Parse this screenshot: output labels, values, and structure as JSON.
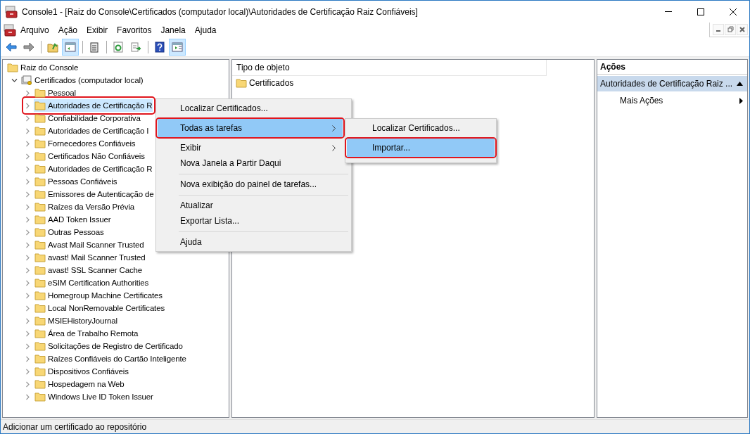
{
  "window": {
    "title": "Console1 - [Raiz do Console\\Certificados (computador local)\\Autoridades de Certificação Raiz Confiáveis]"
  },
  "menu_bar": [
    "Arquivo",
    "Ação",
    "Exibir",
    "Favoritos",
    "Janela",
    "Ajuda"
  ],
  "toolbar": [
    [
      {
        "pressed": false
      },
      {
        "pressed": false
      }
    ],
    [
      {
        "pressed": false
      },
      {
        "pressed": true
      }
    ],
    [
      {
        "pressed": false
      }
    ],
    [
      {
        "pressed": false
      },
      {
        "pressed": false
      }
    ],
    [
      {
        "pressed": false
      },
      {
        "pressed": true
      }
    ]
  ],
  "tree": [
    {
      "label": "Raiz do Console",
      "selected": false,
      "annotated": false,
      "children": [
        {
          "label": "Certificados (computador local)",
          "kind": "store",
          "expanded": true,
          "selected": false,
          "annotated": false,
          "children": [
            {
              "label": "Pessoal",
              "expanded": false,
              "selected": false,
              "annotated": false
            },
            {
              "label": "Autoridades de Certificação R",
              "expanded": false,
              "selected": true,
              "annotated": true
            },
            {
              "label": "Confiabilidade Corporativa",
              "expanded": false,
              "selected": false,
              "annotated": false
            },
            {
              "label": "Autoridades de Certificação I",
              "expanded": false,
              "selected": false,
              "annotated": false
            },
            {
              "label": "Fornecedores Confiáveis",
              "expanded": false,
              "selected": false,
              "annotated": false
            },
            {
              "label": "Certificados Não Confiáveis",
              "expanded": false,
              "selected": false,
              "annotated": false
            },
            {
              "label": "Autoridades de Certificação R",
              "expanded": false,
              "selected": false,
              "annotated": false
            },
            {
              "label": "Pessoas Confiáveis",
              "expanded": false,
              "selected": false,
              "annotated": false
            },
            {
              "label": "Emissores de Autenticação de",
              "expanded": false,
              "selected": false,
              "annotated": false
            },
            {
              "label": "Raízes da Versão Prévia",
              "expanded": false,
              "selected": false,
              "annotated": false
            },
            {
              "label": "AAD Token Issuer",
              "expanded": false,
              "selected": false,
              "annotated": false
            },
            {
              "label": "Outras Pessoas",
              "expanded": false,
              "selected": false,
              "annotated": false
            },
            {
              "label": "Avast Mail Scanner Trusted",
              "expanded": false,
              "selected": false,
              "annotated": false
            },
            {
              "label": "avast! Mail Scanner Trusted",
              "expanded": false,
              "selected": false,
              "annotated": false
            },
            {
              "label": "avast! SSL Scanner Cache",
              "expanded": false,
              "selected": false,
              "annotated": false
            },
            {
              "label": "eSIM Certification Authorities",
              "expanded": false,
              "selected": false,
              "annotated": false
            },
            {
              "label": "Homegroup Machine Certificates",
              "expanded": false,
              "selected": false,
              "annotated": false
            },
            {
              "label": "Local NonRemovable Certificates",
              "expanded": false,
              "selected": false,
              "annotated": false
            },
            {
              "label": "MSIEHistoryJournal",
              "expanded": false,
              "selected": false,
              "annotated": false
            },
            {
              "label": "Área de Trabalho Remota",
              "expanded": false,
              "selected": false,
              "annotated": false
            },
            {
              "label": "Solicitações de Registro de Certificado",
              "expanded": false,
              "selected": false,
              "annotated": false
            },
            {
              "label": "Raízes Confiáveis do Cartão Inteligente",
              "expanded": false,
              "selected": false,
              "annotated": false
            },
            {
              "label": "Dispositivos Confiáveis",
              "expanded": false,
              "selected": false,
              "annotated": false
            },
            {
              "label": "Hospedagem na Web",
              "expanded": false,
              "selected": false,
              "annotated": false
            },
            {
              "label": "Windows Live ID Token Issuer",
              "expanded": false,
              "selected": false,
              "annotated": false
            }
          ]
        }
      ]
    }
  ],
  "list": {
    "columns": [
      "Tipo de objeto"
    ],
    "rows": [
      "Certificados"
    ]
  },
  "actions": {
    "title": "Ações",
    "section": "Autoridades de Certificação Raiz ...",
    "items": [
      "Mais Ações"
    ]
  },
  "context_menu": [
    {
      "kind": "item",
      "label": "Localizar Certificados...",
      "submenu": false,
      "selected": false,
      "annotated": false
    },
    {
      "kind": "item",
      "label": "Todas as tarefas",
      "submenu": true,
      "selected": true,
      "annotated": true
    },
    {
      "kind": "item",
      "label": "Exibir",
      "submenu": true,
      "selected": false,
      "annotated": false
    },
    {
      "kind": "item",
      "label": "Nova Janela a Partir Daqui",
      "submenu": false,
      "selected": false,
      "annotated": false
    },
    {
      "kind": "separator"
    },
    {
      "kind": "item",
      "label": "Nova exibição do painel de tarefas...",
      "submenu": false,
      "selected": false,
      "annotated": false
    },
    {
      "kind": "separator"
    },
    {
      "kind": "item",
      "label": "Atualizar",
      "submenu": false,
      "selected": false,
      "annotated": false
    },
    {
      "kind": "item",
      "label": "Exportar Lista...",
      "submenu": false,
      "selected": false,
      "annotated": false
    },
    {
      "kind": "separator"
    },
    {
      "kind": "item",
      "label": "Ajuda",
      "submenu": false,
      "selected": false,
      "annotated": false
    }
  ],
  "submenu": [
    {
      "kind": "item",
      "label": "Localizar Certificados...",
      "submenu": false,
      "selected": false,
      "annotated": false
    },
    {
      "kind": "item",
      "label": "Importar...",
      "submenu": false,
      "selected": true,
      "annotated": true
    }
  ],
  "status_bar": "Adicionar um certificado ao repositório"
}
